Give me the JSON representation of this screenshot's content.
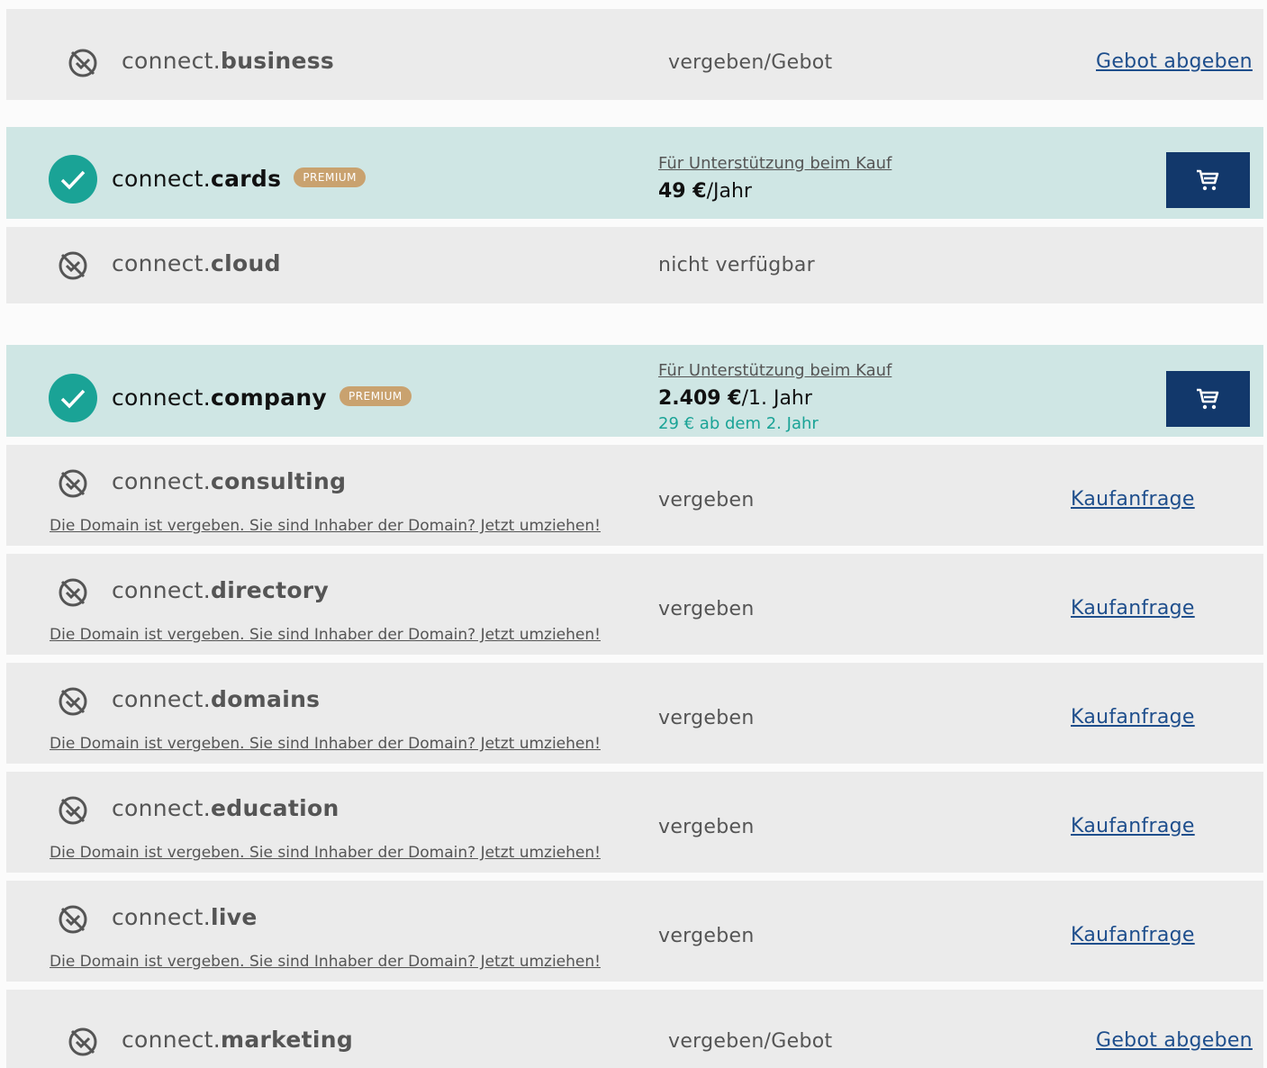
{
  "rows": [
    {
      "name": "connect.",
      "tld": "business",
      "status": "vergeben/Gebot",
      "action": "Gebot abgeben"
    },
    {
      "name": "connect.",
      "tld": "cards",
      "badge": "PREMIUM",
      "support_link": "Für Unterstützung beim Kauf",
      "price_amount": "49 €",
      "price_period": "/Jahr"
    },
    {
      "name": "connect.",
      "tld": "cloud",
      "status": "nicht verfügbar"
    },
    {
      "name": "connect.",
      "tld": "company",
      "badge": "PREMIUM",
      "support_link": "Für Unterstützung beim Kauf",
      "price_amount": "2.409 €",
      "price_period": "/1. Jahr",
      "renewal": "29 € ab dem 2. Jahr"
    },
    {
      "name": "connect.",
      "tld": "consulting",
      "status": "vergeben",
      "action": "Kaufanfrage",
      "note": "Die Domain ist vergeben. Sie sind Inhaber der Domain? Jetzt umziehen!"
    },
    {
      "name": "connect.",
      "tld": "directory",
      "status": "vergeben",
      "action": "Kaufanfrage",
      "note": "Die Domain ist vergeben. Sie sind Inhaber der Domain? Jetzt umziehen!"
    },
    {
      "name": "connect.",
      "tld": "domains",
      "status": "vergeben",
      "action": "Kaufanfrage",
      "note": "Die Domain ist vergeben. Sie sind Inhaber der Domain? Jetzt umziehen!"
    },
    {
      "name": "connect.",
      "tld": "education",
      "status": "vergeben",
      "action": "Kaufanfrage",
      "note": "Die Domain ist vergeben. Sie sind Inhaber der Domain? Jetzt umziehen!"
    },
    {
      "name": "connect.",
      "tld": "live",
      "status": "vergeben",
      "action": "Kaufanfrage",
      "note": "Die Domain ist vergeben. Sie sind Inhaber der Domain? Jetzt umziehen!"
    },
    {
      "name": "connect.",
      "tld": "marketing",
      "status": "vergeben/Gebot",
      "action": "Gebot abgeben"
    }
  ],
  "icons": {
    "taken": "unavailable-icon",
    "available": "check-circle-icon",
    "cart": "cart-icon"
  },
  "colors": {
    "available_row_bg": "#cfe6e4",
    "taken_row_bg": "#ebebeb",
    "check_green": "#1aa396",
    "cart_button": "#12386b",
    "link_blue": "#1e4e8c",
    "premium_badge": "#c9a26f"
  }
}
